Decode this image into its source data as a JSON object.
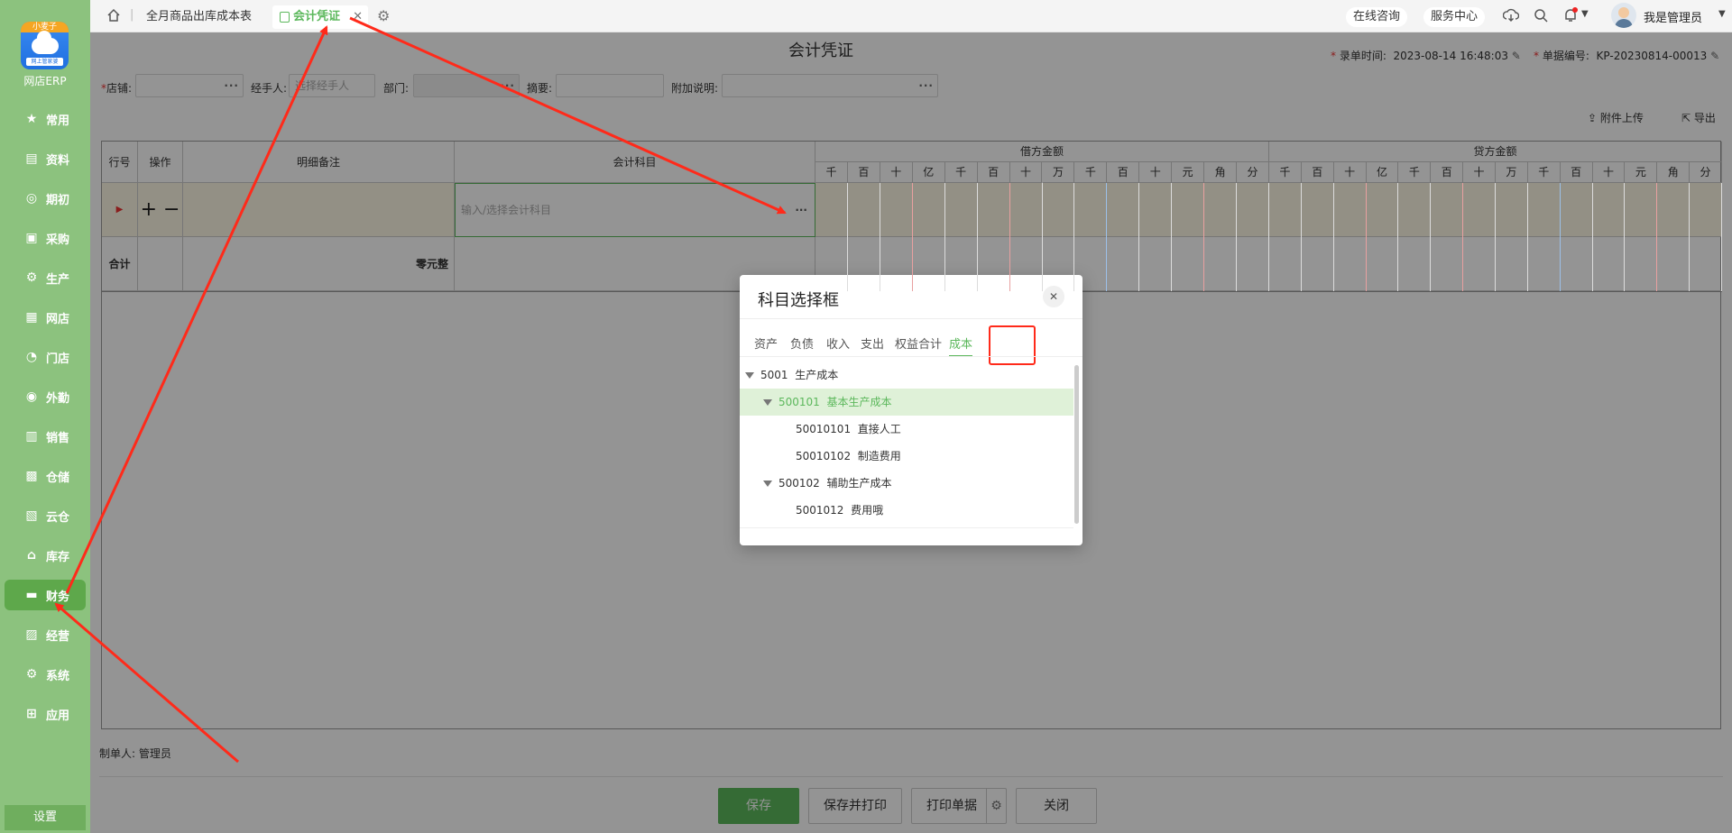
{
  "sidebar": {
    "logo_ribbon": "小麦子",
    "logo_tag": "网上管家婆",
    "logo_text": "网店ERP",
    "items": [
      {
        "label": "常用",
        "icon": "star-icon"
      },
      {
        "label": "资料",
        "icon": "document-icon"
      },
      {
        "label": "期初",
        "icon": "target-icon"
      },
      {
        "label": "采购",
        "icon": "purchase-icon"
      },
      {
        "label": "生产",
        "icon": "production-icon"
      },
      {
        "label": "网店",
        "icon": "shop-icon"
      },
      {
        "label": "门店",
        "icon": "pie-icon"
      },
      {
        "label": "外勤",
        "icon": "field-icon"
      },
      {
        "label": "销售",
        "icon": "chart-icon"
      },
      {
        "label": "仓储",
        "icon": "warehouse-icon"
      },
      {
        "label": "云仓",
        "icon": "cloud-warehouse-icon"
      },
      {
        "label": "库存",
        "icon": "home-icon"
      },
      {
        "label": "财务",
        "icon": "finance-icon"
      },
      {
        "label": "经营",
        "icon": "business-icon"
      },
      {
        "label": "系统",
        "icon": "system-icon"
      },
      {
        "label": "应用",
        "icon": "plus-box-icon"
      }
    ],
    "active_index": 12,
    "settings_label": "设置"
  },
  "topbar": {
    "tab1": "全月商品出库成本表",
    "tab2": "会计凭证",
    "online_consult": "在线咨询",
    "service_center": "服务中心",
    "user_name": "我是管理员"
  },
  "voucher": {
    "title": "会计凭证",
    "entry_time_label": "录单时间:",
    "entry_time": "2023-08-14 16:48:03",
    "doc_no_label": "单据编号:",
    "doc_no": "KP-20230814-00013",
    "store_label": "店铺:",
    "handler_label": "经手人:",
    "handler_placeholder": "选择经手人",
    "dept_label": "部门:",
    "summary_label": "摘要:",
    "note_label": "附加说明:",
    "attach_label": "附件上传",
    "export_label": "导出",
    "maker_label": "制单人:",
    "maker": "管理员"
  },
  "table": {
    "headers": {
      "row_no": "行号",
      "ops": "操作",
      "remark": "明细备注",
      "subject": "会计科目",
      "debit": "借方金额",
      "credit": "贷方金额"
    },
    "digits": [
      "千",
      "百",
      "十",
      "亿",
      "千",
      "百",
      "十",
      "万",
      "千",
      "百",
      "十",
      "元",
      "角",
      "分"
    ],
    "subject_placeholder": "输入/选择会计科目",
    "plus": "+",
    "minus": "−",
    "total_label": "合计",
    "round_label": "零元整"
  },
  "buttons": {
    "save": "保存",
    "save_print": "保存并打印",
    "print_doc": "打印单据",
    "close": "关闭"
  },
  "modal": {
    "title": "科目选择框",
    "tabs": [
      "资产",
      "负债",
      "收入",
      "支出",
      "权益合计",
      "成本"
    ],
    "active_tab": 5,
    "tree": [
      {
        "code": "5001",
        "name": "生产成本",
        "level": 0,
        "expanded": true
      },
      {
        "code": "500101",
        "name": "基本生产成本",
        "level": 1,
        "expanded": true,
        "selected": true
      },
      {
        "code": "50010101",
        "name": "直接人工",
        "level": 2
      },
      {
        "code": "50010102",
        "name": "制造费用",
        "level": 2
      },
      {
        "code": "500102",
        "name": "辅助生产成本",
        "level": 1,
        "expanded": true
      },
      {
        "code": "5001012",
        "name": "费用哦",
        "level": 2
      }
    ]
  },
  "colors": {
    "sidebar": "#8cc27e",
    "active": "#5ea84b",
    "accent_green": "#5cb85c",
    "annotation_red": "#ff2a1a"
  }
}
